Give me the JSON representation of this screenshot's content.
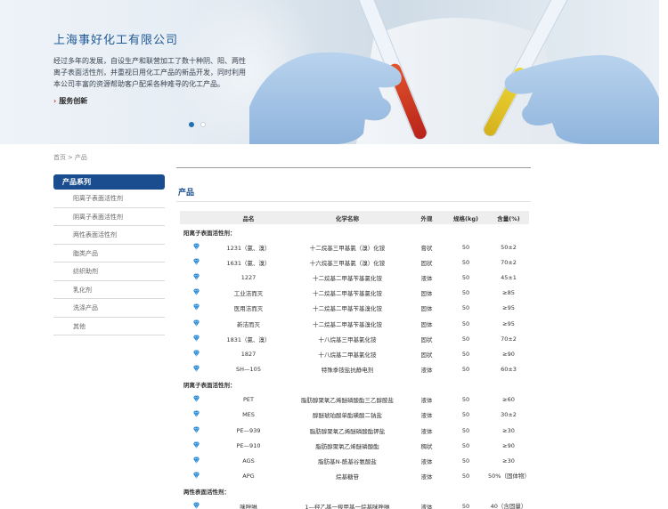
{
  "banner": {
    "title": "上海事好化工有限公司",
    "description": "经过多年的发展，自设生产和联营加工了数十种阴、阳、两性离子表面活性剂，并重视日用化工产品的新品开发，同时利用本公司丰富的资源帮助客户配采各种难寻的化工产品。",
    "more_label": "服务创新",
    "slides": 2,
    "active_slide": 1
  },
  "breadcrumb": {
    "home": "首页",
    "separator": ">",
    "current": "产品"
  },
  "sidebar": {
    "title": "产品系列",
    "items": [
      {
        "label": "阳离子表面活性剂"
      },
      {
        "label": "阴离子表面活性剂"
      },
      {
        "label": "两性表面活性剂"
      },
      {
        "label": "脂类产品"
      },
      {
        "label": "纺织助剂"
      },
      {
        "label": "乳化剂"
      },
      {
        "label": "洗涤产品"
      },
      {
        "label": "其他"
      }
    ]
  },
  "main": {
    "title": "产品",
    "columns": [
      "",
      "品名",
      "化学名称",
      "外观",
      "规格(kg)",
      "含量(%)"
    ],
    "groups": [
      {
        "name": "阳离子表面活性剂：",
        "rows": [
          {
            "name": "1231（氯、溴）",
            "chem": "十二烷基三甲基氯（溴）化铵",
            "appearance": "膏状",
            "spec": "50",
            "content": "50±2"
          },
          {
            "name": "1631（氯、溴）",
            "chem": "十六烷基三甲基氯（溴）化铵",
            "appearance": "固状",
            "spec": "50",
            "content": "70±2"
          },
          {
            "name": "1227",
            "chem": "十二烷基二甲基苄基氯化铵",
            "appearance": "液体",
            "spec": "50",
            "content": "45±1"
          },
          {
            "name": "工业洁而灭",
            "chem": "十二烷基二甲基苄基氯化铵",
            "appearance": "固体",
            "spec": "50",
            "content": "≥85"
          },
          {
            "name": "医用洁而灭",
            "chem": "十二烷基二甲基苄基溴化铵",
            "appearance": "固体",
            "spec": "50",
            "content": "≥95"
          },
          {
            "name": "新洁而灭",
            "chem": "十二烷基二甲基苄基溴化铵",
            "appearance": "固体",
            "spec": "50",
            "content": "≥95"
          },
          {
            "name": "1831（氯、溴）",
            "chem": "十八烷基三甲基氯化铵",
            "appearance": "固状",
            "spec": "50",
            "content": "70±2"
          },
          {
            "name": "1827",
            "chem": "十八烷基二甲基氯化铵",
            "appearance": "固状",
            "spec": "50",
            "content": "≥90"
          },
          {
            "name": "SH—105",
            "chem": "特殊季铵盐抗静电剂",
            "appearance": "液体",
            "spec": "50",
            "content": "60±3"
          }
        ]
      },
      {
        "name": "阴离子表面活性剂：",
        "rows": [
          {
            "name": "PET",
            "chem": "脂肪醇聚氧乙烯醚磷酸酯三乙醇胺盐",
            "appearance": "液体",
            "spec": "50",
            "content": "≥60"
          },
          {
            "name": "MES",
            "chem": "醇醚琥珀酸单酯磺酸二钠盐",
            "appearance": "液体",
            "spec": "50",
            "content": "30±2"
          },
          {
            "name": "PE—939",
            "chem": "脂肪醇聚氧乙烯醚磷酸酯钾盐",
            "appearance": "液体",
            "spec": "50",
            "content": "≥30"
          },
          {
            "name": "PE—910",
            "chem": "脂肪醇聚氧乙烯醚磷酸酯",
            "appearance": "稠状",
            "spec": "50",
            "content": "≥90"
          },
          {
            "name": "AGS",
            "chem": "脂肪基N-酰基谷氨酸盐",
            "appearance": "液体",
            "spec": "50",
            "content": "≥30"
          },
          {
            "name": "APG",
            "chem": "烷基糖苷",
            "appearance": "液体",
            "spec": "50",
            "content": "50%（固体物）"
          }
        ]
      },
      {
        "name": "两性表面活性剂：",
        "rows": [
          {
            "name": "咪唑啉",
            "chem": "1—羟乙基一羧甲基一烷基咪唑啉",
            "appearance": "液体",
            "spec": "50",
            "content": "40（含固量）"
          }
        ]
      }
    ]
  },
  "colors": {
    "accent": "#1a4d8f",
    "banner_title": "#1f5a96",
    "arrow": "#c0392b",
    "gem": "#1e7fcf"
  }
}
